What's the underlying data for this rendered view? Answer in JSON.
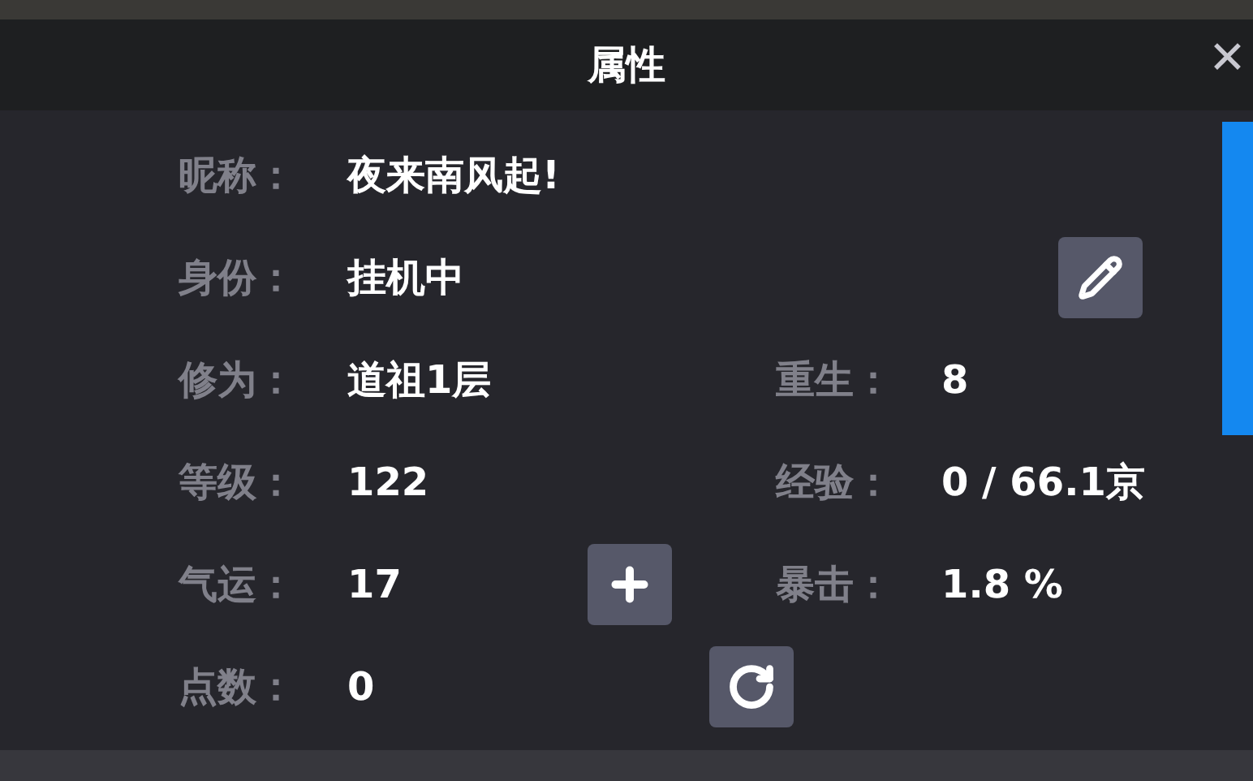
{
  "window": {
    "title": "属性",
    "close": "✕"
  },
  "rows": [
    {
      "label": "昵称：",
      "value": "夜来南风起!",
      "kind": "plain"
    },
    {
      "label": "身份：",
      "value": "挂机中",
      "kind": "edit"
    },
    {
      "label": "修为：",
      "value": "道祖1层",
      "kind": "plain",
      "right": {
        "label": "重生：",
        "value": "8"
      }
    },
    {
      "label": "等级：",
      "value": "122",
      "kind": "plain",
      "right": {
        "label": "经验：",
        "value": "0 / 66.1京"
      }
    },
    {
      "label": "气运：",
      "value": "17",
      "kind": "plus",
      "right": {
        "label": "暴击：",
        "value": "1.8 %"
      }
    },
    {
      "label": "点数：",
      "value": "0",
      "kind": "reset"
    }
  ]
}
